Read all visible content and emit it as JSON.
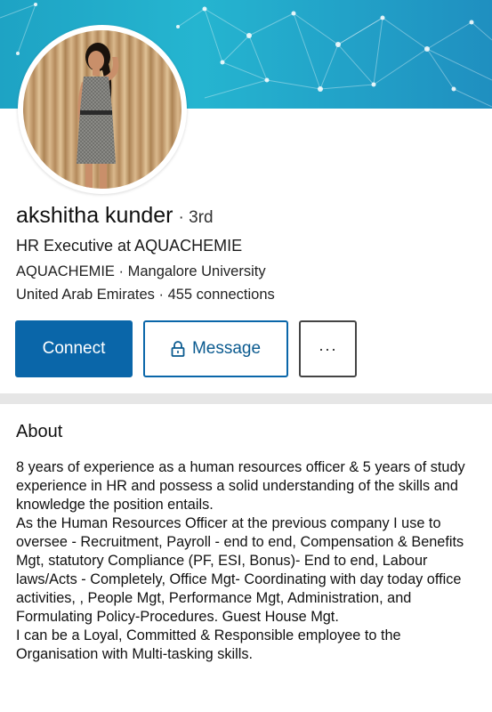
{
  "profile": {
    "name": "akshitha kunder",
    "degree": "· 3rd",
    "headline": "HR Executive at AQUACHEMIE",
    "education": "AQUACHEMIE  · Mangalore University",
    "location": "United Arab Emirates · 455 connections"
  },
  "actions": {
    "connect_label": "Connect",
    "message_label": "Message",
    "more_label": "···"
  },
  "about": {
    "title": "About",
    "paragraphs": [
      "8 years of experience as a human resources officer & 5 years of study experience in HR and possess a solid understanding of the skills and knowledge the position entails.",
      "As the Human Resources Officer at the previous company I use to oversee - Recruitment, Payroll - end to end, Compensation & Benefits Mgt, statutory Compliance (PF, ESI, Bonus)- End to end, Labour laws/Acts - Completely, Office Mgt- Coordinating with day today office activities, , People Mgt, Performance Mgt, Administration, and Formulating Policy-Procedures. Guest House Mgt.",
      "I can be a Loyal, Committed & Responsible employee to the Organisation with Multi-tasking skills."
    ]
  },
  "icons": {
    "message": "lock-icon",
    "more": "ellipsis-icon"
  },
  "colors": {
    "accent": "#0a66a9",
    "banner": "#1ea3c4"
  }
}
